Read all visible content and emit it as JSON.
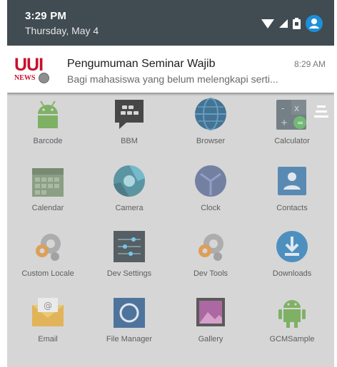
{
  "status_bar": {
    "time": "3:29 PM",
    "date": "Thursday, May 4",
    "icons": [
      "wifi-icon",
      "signal-icon",
      "battery-icon",
      "user-avatar-icon"
    ]
  },
  "notification": {
    "logo": "UUI NEWS",
    "title": "Pengumuman Seminar Wajib",
    "time": "8:29 AM",
    "body": "Bagi mahasiswa yang belum melengkapi serti..."
  },
  "apps": [
    {
      "label": "Barcode",
      "icon": "android-icon"
    },
    {
      "label": "BBM",
      "icon": "bbm-icon"
    },
    {
      "label": "Browser",
      "icon": "globe-icon"
    },
    {
      "label": "Calculator",
      "icon": "calculator-icon"
    },
    {
      "label": "Calendar",
      "icon": "calendar-icon"
    },
    {
      "label": "Camera",
      "icon": "camera-icon"
    },
    {
      "label": "Clock",
      "icon": "clock-icon"
    },
    {
      "label": "Contacts",
      "icon": "contacts-icon"
    },
    {
      "label": "Custom Locale",
      "icon": "gear-icon"
    },
    {
      "label": "Dev Settings",
      "icon": "sliders-icon"
    },
    {
      "label": "Dev Tools",
      "icon": "gear-icon"
    },
    {
      "label": "Downloads",
      "icon": "download-icon"
    },
    {
      "label": "Email",
      "icon": "email-icon"
    },
    {
      "label": "File Manager",
      "icon": "folder-icon"
    },
    {
      "label": "Gallery",
      "icon": "gallery-icon"
    },
    {
      "label": "GCMSample",
      "icon": "android-icon"
    }
  ],
  "colors": {
    "status_bar_bg": "#404b52",
    "avatar_accent": "#1e8fd8",
    "logo_red": "#c8102e"
  }
}
